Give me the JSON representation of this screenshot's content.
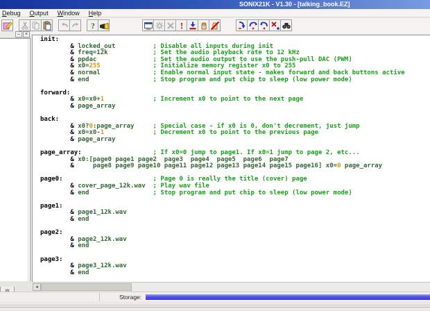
{
  "window": {
    "title": "SONIX21K - V1.30 - [talking_book.EZ]"
  },
  "menubar": {
    "items": [
      "Debug",
      "Output",
      "Window",
      "Help"
    ]
  },
  "toolbar": {
    "groups": [
      {
        "buttons": [
          {
            "name": "assemble-button",
            "icon": "assemble-icon",
            "enabled": true,
            "gap": false
          },
          {
            "name": "cut-button",
            "icon": "cut-icon",
            "enabled": false,
            "gap": true
          },
          {
            "name": "copy-button",
            "icon": "copy-icon",
            "enabled": false,
            "gap": false
          },
          {
            "name": "paste-button",
            "icon": "paste-icon",
            "enabled": true,
            "gap": false
          },
          {
            "name": "undo-button",
            "icon": "undo-icon",
            "enabled": false,
            "gap": true
          },
          {
            "name": "redo-button",
            "icon": "redo-icon",
            "enabled": false,
            "gap": false
          },
          {
            "name": "help-button",
            "icon": "help-icon",
            "enabled": true,
            "gap": true
          },
          {
            "name": "find-in-files-button",
            "icon": "find-in-files-icon",
            "enabled": true,
            "gap": false
          }
        ]
      },
      {
        "buttons": [
          {
            "name": "emulator-button",
            "icon": "emulator-icon",
            "enabled": true,
            "gap": false
          },
          {
            "name": "settings-button",
            "icon": "gear-icon",
            "enabled": false,
            "gap": false
          },
          {
            "name": "erase-button",
            "icon": "erase-icon",
            "enabled": false,
            "gap": false
          },
          {
            "name": "verify-button",
            "icon": "exclamation-icon",
            "enabled": true,
            "gap": false
          },
          {
            "name": "download-button",
            "icon": "download-icon",
            "enabled": true,
            "gap": false
          },
          {
            "name": "pause-button",
            "icon": "hand-icon",
            "enabled": true,
            "gap": false
          },
          {
            "name": "stop-button",
            "icon": "hand-stop-icon",
            "enabled": true,
            "gap": false
          }
        ]
      },
      {
        "buttons": [
          {
            "name": "step-into-button",
            "icon": "step-into-icon",
            "enabled": true,
            "gap": false
          },
          {
            "name": "step-over-button",
            "icon": "step-over-icon",
            "enabled": true,
            "gap": false
          },
          {
            "name": "step-out-button",
            "icon": "step-out-icon",
            "enabled": true,
            "gap": false
          },
          {
            "name": "stop-debug-button",
            "icon": "stop-debug-icon",
            "enabled": true,
            "gap": false
          },
          {
            "name": "find-button",
            "icon": "binoculars-icon",
            "enabled": true,
            "gap": false
          }
        ]
      }
    ]
  },
  "left_panel": {
    "minimize_glyph": "–",
    "close_glyph": "×",
    "tab_label": "w"
  },
  "hscroll": {
    "left_arrow": "◄"
  },
  "statusbar": {
    "storage_label": "Storage:"
  },
  "colors": {
    "title_blue": "#2e55b8",
    "label_black": "#000000",
    "instruction_green": "#336633",
    "comment_green": "#18a018",
    "number_orange": "#dd9500",
    "progress_blue": "#5252e6"
  },
  "editor": {
    "lines": [
      [
        [
          "lb",
          "init:"
        ]
      ],
      [
        [
          "pl",
          "        & "
        ],
        [
          "in",
          "locked_out"
        ],
        [
          "pl",
          "          "
        ],
        [
          "cm",
          "; Disable all inputs during init"
        ]
      ],
      [
        [
          "pl",
          "        & "
        ],
        [
          "in",
          "freq=12k"
        ],
        [
          "pl",
          "            "
        ],
        [
          "cm",
          "; Set the audio playback rate to 12 kHz"
        ]
      ],
      [
        [
          "pl",
          "        & "
        ],
        [
          "in",
          "ppdac"
        ],
        [
          "pl",
          "               "
        ],
        [
          "cm",
          "; Set the audio output to use the push-pull DAC (PWM)"
        ]
      ],
      [
        [
          "pl",
          "        & "
        ],
        [
          "in",
          "x0="
        ],
        [
          "nu",
          "255"
        ],
        [
          "pl",
          "              "
        ],
        [
          "cm",
          "; Initialize memory register x0 to 255"
        ]
      ],
      [
        [
          "pl",
          "        & "
        ],
        [
          "in",
          "normal"
        ],
        [
          "pl",
          "              "
        ],
        [
          "cm",
          "; Enable normal input state - makes forward and back buttons active"
        ]
      ],
      [
        [
          "pl",
          "        & "
        ],
        [
          "in",
          "end"
        ],
        [
          "pl",
          "                 "
        ],
        [
          "cm",
          "; Stop program and put chip to sleep (low power mode)"
        ]
      ],
      [],
      [
        [
          "lb",
          "forward:"
        ]
      ],
      [
        [
          "pl",
          "        & "
        ],
        [
          "in",
          "x0=x0+"
        ],
        [
          "nu",
          "1"
        ],
        [
          "pl",
          "             "
        ],
        [
          "cm",
          "; Increment x0 to point to the next page"
        ]
      ],
      [
        [
          "pl",
          "        & "
        ],
        [
          "in",
          "page_array"
        ]
      ],
      [],
      [
        [
          "lb",
          "back:"
        ]
      ],
      [
        [
          "pl",
          "        & "
        ],
        [
          "in",
          "x0?"
        ],
        [
          "nu",
          "0"
        ],
        [
          "in",
          ":page_array"
        ],
        [
          "pl",
          "     "
        ],
        [
          "cm",
          "; Special case - if x0 is 0, don't decrement, just jump"
        ]
      ],
      [
        [
          "pl",
          "        & "
        ],
        [
          "in",
          "x0=x0-"
        ],
        [
          "nu",
          "1"
        ],
        [
          "pl",
          "             "
        ],
        [
          "cm",
          "; Decrement x0 to point to the previous page"
        ]
      ],
      [
        [
          "pl",
          "        & "
        ],
        [
          "in",
          "page_array"
        ]
      ],
      [],
      [
        [
          "lb",
          "page_array:"
        ],
        [
          "pl",
          "                   "
        ],
        [
          "cm",
          "; If x0=0 jump to page1. If x0=1 jump to page 2, etc..."
        ]
      ],
      [
        [
          "pl",
          "        & "
        ],
        [
          "in",
          "x0:[page0 page1 page2  page3  page4  page5  page6  page7"
        ]
      ],
      [
        [
          "pl",
          "        & "
        ],
        [
          "in",
          "    page8 page9 page10 page11 page12 page13 page14 page15 page16] x0="
        ],
        [
          "nu",
          "0"
        ],
        [
          "in",
          " page_array"
        ]
      ],
      [],
      [
        [
          "lb",
          "page0:"
        ],
        [
          "pl",
          "                        "
        ],
        [
          "cm",
          "; Page 0 is really the title (cover) page"
        ]
      ],
      [
        [
          "pl",
          "        & "
        ],
        [
          "in",
          "cover_page_12k.wav"
        ],
        [
          "pl",
          "  "
        ],
        [
          "cm",
          "; Play wav file"
        ]
      ],
      [
        [
          "pl",
          "        & "
        ],
        [
          "in",
          "end"
        ],
        [
          "pl",
          "                 "
        ],
        [
          "cm",
          "; Stop program and put chip to sleep (low power mode)"
        ]
      ],
      [],
      [
        [
          "lb",
          "page1:"
        ]
      ],
      [
        [
          "pl",
          "        & "
        ],
        [
          "in",
          "page1_12k.wav"
        ]
      ],
      [
        [
          "pl",
          "        & "
        ],
        [
          "in",
          "end"
        ]
      ],
      [],
      [
        [
          "lb",
          "page2:"
        ]
      ],
      [
        [
          "pl",
          "        & "
        ],
        [
          "in",
          "page2_12k.wav"
        ]
      ],
      [
        [
          "pl",
          "        & "
        ],
        [
          "in",
          "end"
        ]
      ],
      [],
      [
        [
          "lb",
          "page3:"
        ]
      ],
      [
        [
          "pl",
          "        & "
        ],
        [
          "in",
          "page3_12k.wav"
        ]
      ],
      [
        [
          "pl",
          "        & "
        ],
        [
          "in",
          "end"
        ]
      ]
    ]
  }
}
